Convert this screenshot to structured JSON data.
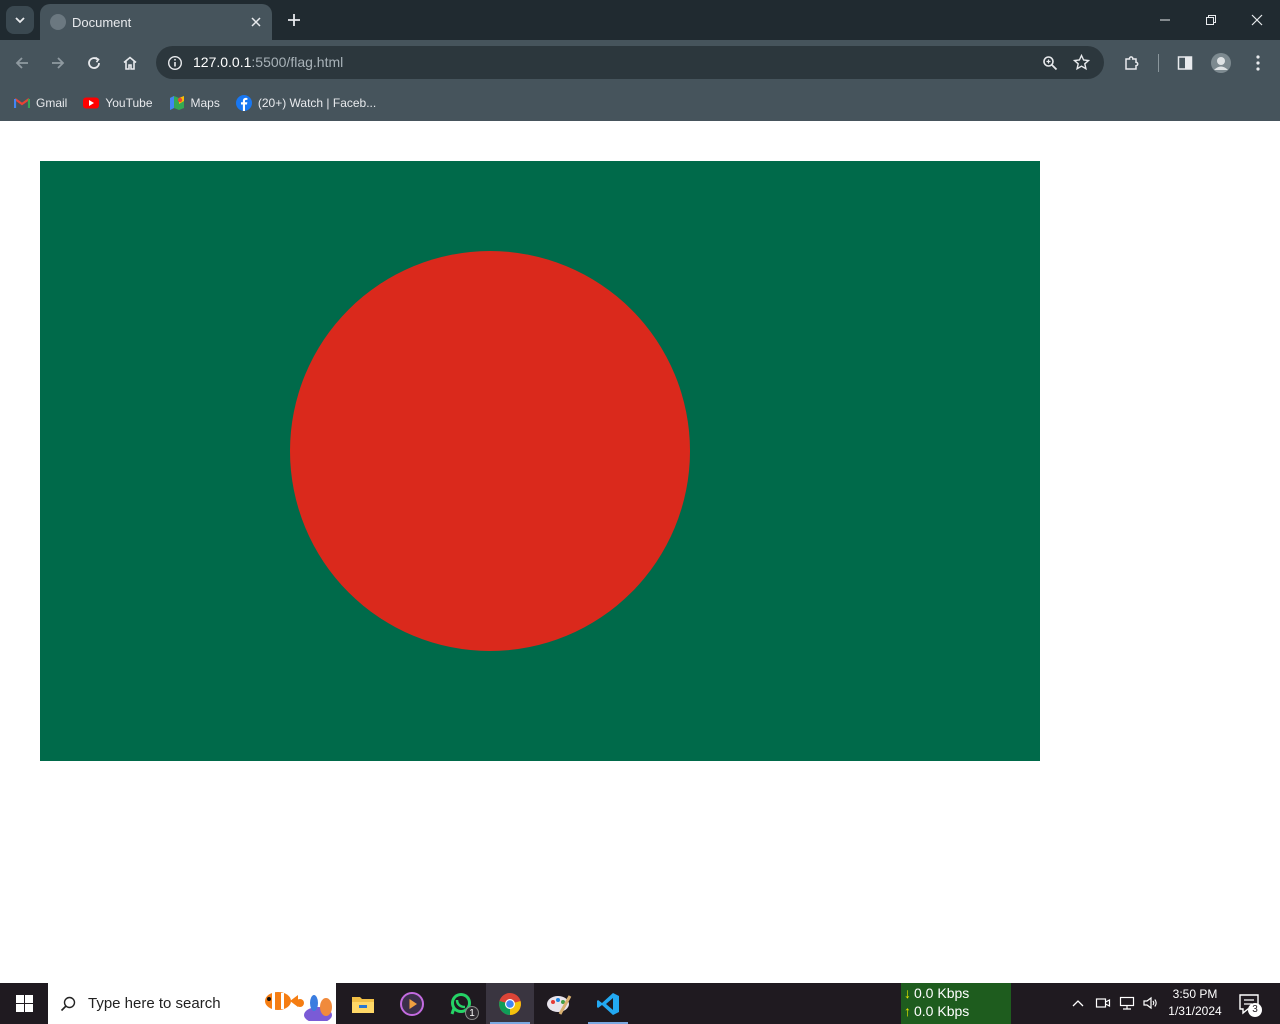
{
  "browser": {
    "tab_title": "Document",
    "url_host": "127.0.0.1",
    "url_rest": ":5500/flag.html",
    "bookmarks": [
      {
        "label": "Gmail",
        "icon": "gmail-icon"
      },
      {
        "label": "YouTube",
        "icon": "youtube-icon"
      },
      {
        "label": "Maps",
        "icon": "maps-icon"
      },
      {
        "label": "(20+) Watch | Faceb...",
        "icon": "facebook-icon"
      }
    ]
  },
  "page": {
    "flag": {
      "field_color": "#006a4a",
      "disc_color": "#da291c"
    }
  },
  "taskbar": {
    "search_placeholder": "Type here to search",
    "whatsapp_badge": "1",
    "net_down": "0.0 Kbps",
    "net_up": "0.0 Kbps",
    "time": "3:50 PM",
    "date": "1/31/2024",
    "notification_count": "3"
  }
}
